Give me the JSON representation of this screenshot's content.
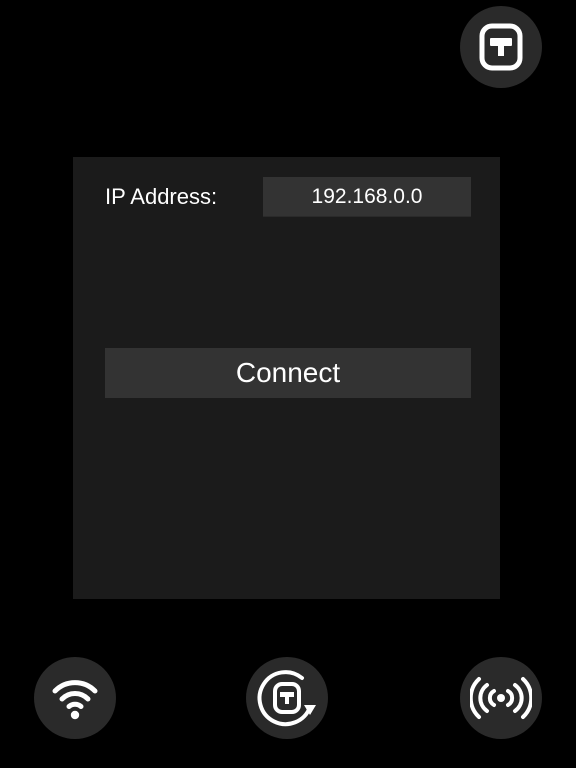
{
  "connection_panel": {
    "ip_label": "IP Address:",
    "ip_value": "192.168.0.0",
    "connect_label": "Connect"
  },
  "buttons": {
    "top_right": {
      "icon": "robot-face-icon"
    },
    "bottom_left": {
      "icon": "wifi-icon"
    },
    "bottom_center": {
      "icon": "robot-rotate-icon"
    },
    "bottom_right": {
      "icon": "broadcast-signal-icon"
    }
  },
  "colors": {
    "background": "#000000",
    "panel": "#1b1b1b",
    "field": "#333333",
    "round_button": "#2a2a2a",
    "foreground": "#ffffff"
  }
}
